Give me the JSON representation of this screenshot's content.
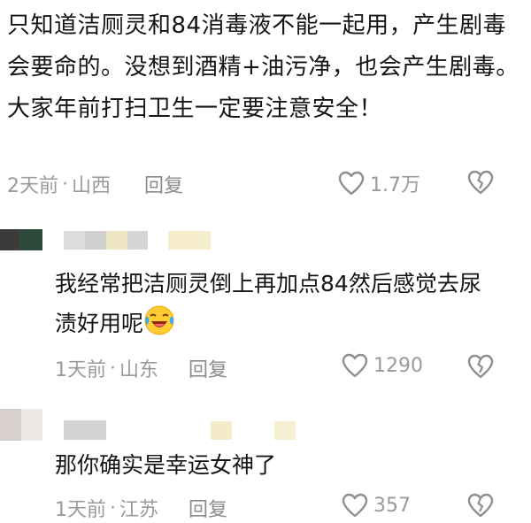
{
  "main_comment": {
    "text": "只知道洁厕灵和84消毒液不能一起用，产生剧毒会要命的。没想到酒精+油污净，也会产生剧毒。大家年前打扫卫生一定要注意安全！",
    "time": "2天前",
    "location": "山西",
    "reply_label": "回复",
    "likes": "1.7万"
  },
  "replies": [
    {
      "text": "我经常把洁厕灵倒上再加点84然后感觉去尿渍好用呢",
      "emoji": "laugh-cry-emoji",
      "time": "1天前",
      "location": "山东",
      "reply_label": "回复",
      "likes": "1290"
    },
    {
      "text": "那你确实是幸运女神了",
      "time": "1天前",
      "location": "江苏",
      "reply_label": "回复",
      "likes": "357"
    }
  ],
  "separator": "·",
  "colors": {
    "text": "#151515",
    "meta": "#9a9a9a",
    "mosaic_gray": "#d9d9d9",
    "mosaic_cream": "#f4eccb"
  }
}
